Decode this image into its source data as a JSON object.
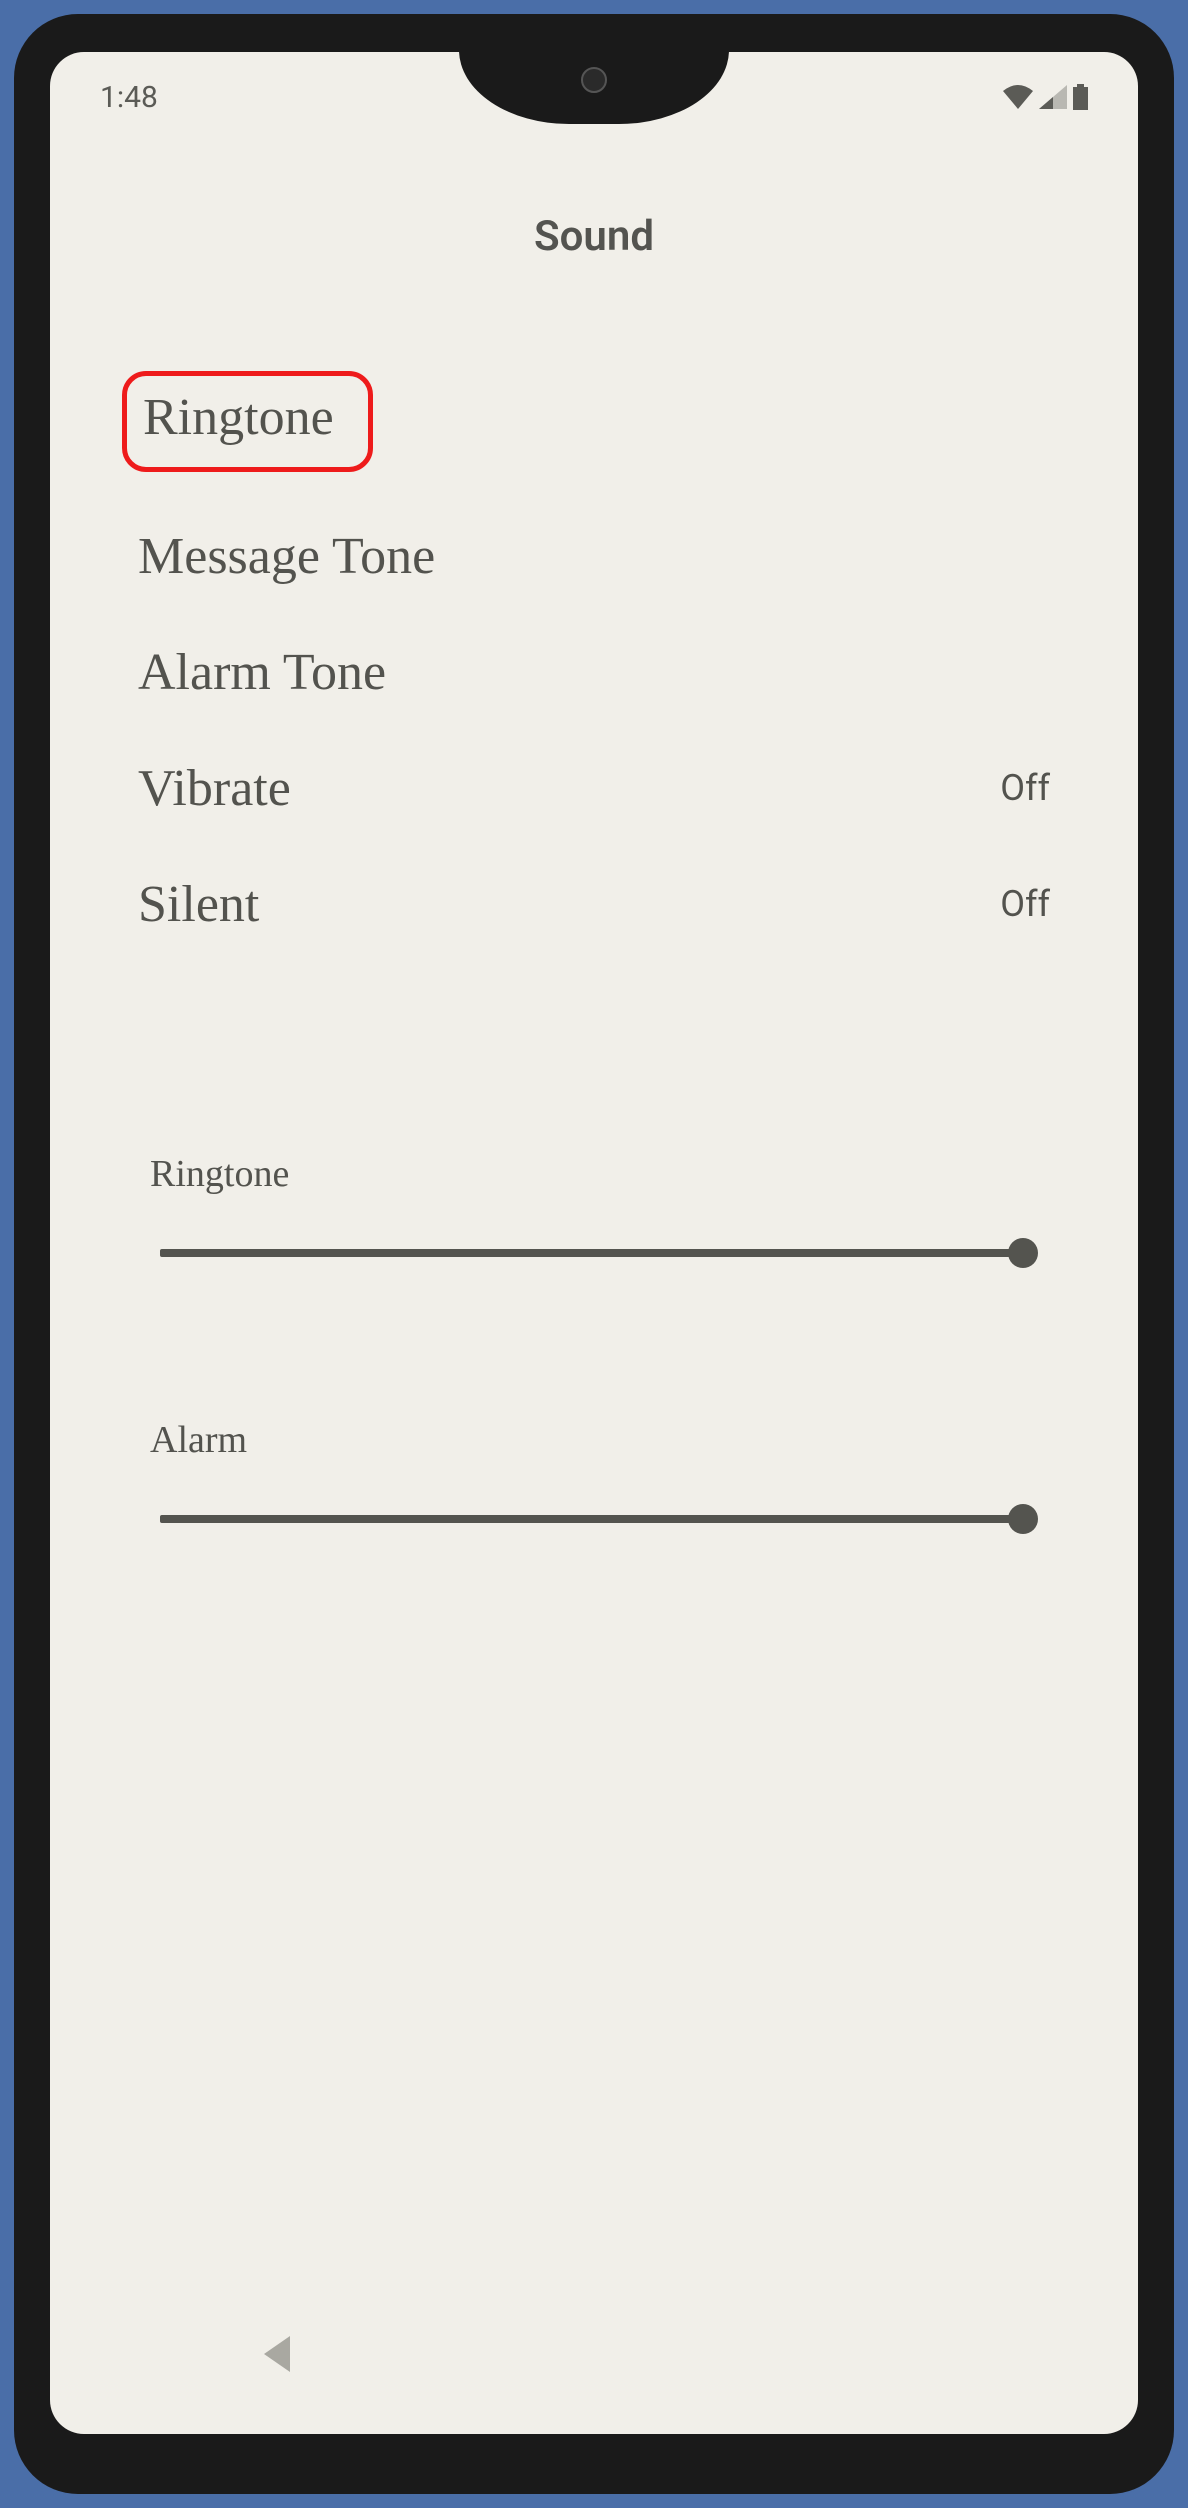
{
  "status": {
    "time": "1:48"
  },
  "page": {
    "title": "Sound"
  },
  "options": {
    "ringtone": {
      "label": "Ringtone"
    },
    "message_tone": {
      "label": "Message Tone"
    },
    "alarm_tone": {
      "label": "Alarm Tone"
    },
    "vibrate": {
      "label": "Vibrate",
      "value": "Off"
    },
    "silent": {
      "label": "Silent",
      "value": "Off"
    }
  },
  "sliders": {
    "ringtone": {
      "label": "Ringtone",
      "value": 100
    },
    "alarm": {
      "label": "Alarm",
      "value": 100
    }
  }
}
